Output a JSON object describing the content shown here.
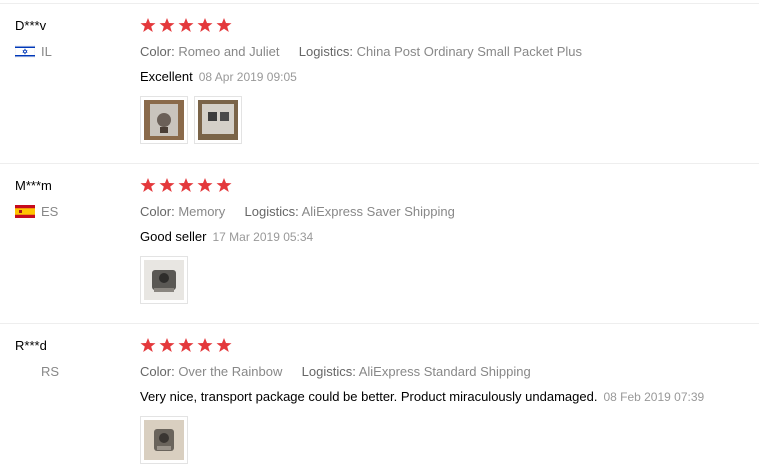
{
  "reviews": [
    {
      "user": "D***v",
      "country": "IL",
      "flag_icon": "israel-flag",
      "stars": 5,
      "color_label": "Color:",
      "color_value": "Romeo and Juliet",
      "logistics_label": "Logistics:",
      "logistics_value": "China Post Ordinary Small Packet Plus",
      "feedback": "Excellent",
      "date": "08 Apr 2019 09:05"
    },
    {
      "user": "M***m",
      "country": "ES",
      "flag_icon": "spain-flag",
      "stars": 5,
      "color_label": "Color:",
      "color_value": "Memory",
      "logistics_label": "Logistics:",
      "logistics_value": "AliExpress Saver Shipping",
      "feedback": "Good seller",
      "date": "17 Mar 2019 05:34"
    },
    {
      "user": "R***d",
      "country": "RS",
      "flag_icon": "serbia-flag",
      "stars": 5,
      "color_label": "Color:",
      "color_value": "Over the Rainbow",
      "logistics_label": "Logistics:",
      "logistics_value": "AliExpress Standard Shipping",
      "feedback": "Very nice, transport package could be better. Product miraculously undamaged.",
      "date": "08 Feb 2019 07:39"
    }
  ],
  "colors": {
    "star": "#e4393c",
    "divider": "#eeeeee",
    "meta": "#888888"
  }
}
